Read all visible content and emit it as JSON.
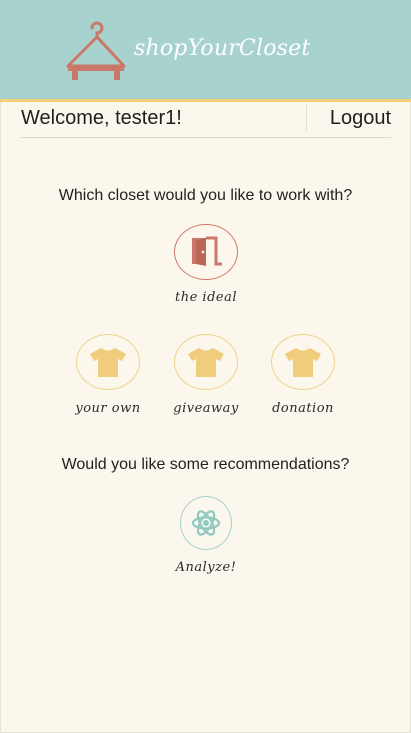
{
  "header": {
    "brand": "shopYourCloset",
    "colors": {
      "header_bg": "#a8d2ce",
      "accent_line": "#f0d27e",
      "hanger": "#c9786a"
    }
  },
  "topbar": {
    "welcome": "Welcome, tester1!",
    "logout": "Logout"
  },
  "closets": {
    "question": "Which closet would you like to work with?",
    "ideal": {
      "label": "the ideal",
      "icon": "door-icon"
    },
    "items": [
      {
        "label": "your own",
        "icon": "shirt-icon"
      },
      {
        "label": "giveaway",
        "icon": "shirt-icon"
      },
      {
        "label": "donation",
        "icon": "shirt-icon"
      }
    ]
  },
  "recommendations": {
    "question": "Would you like some recommendations?",
    "analyze": {
      "label": "Analyze!",
      "icon": "atom-icon"
    }
  }
}
